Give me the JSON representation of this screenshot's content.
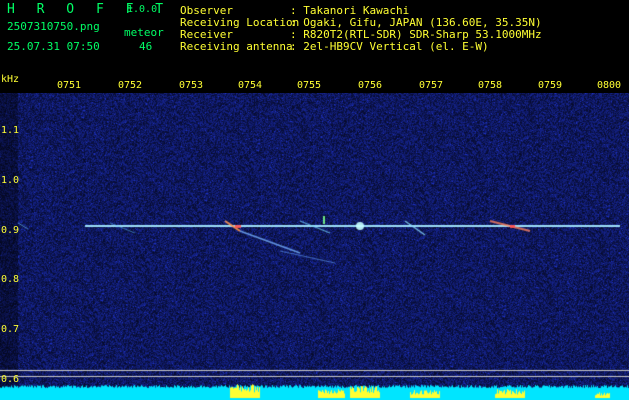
{
  "app": {
    "name": "H R O F F T",
    "version": "1.0.0"
  },
  "file": {
    "name": "2507310750.png",
    "timestamp": "25.07.31 07:50"
  },
  "meteor": {
    "label": "meteor",
    "count": "46"
  },
  "info": {
    "observer": {
      "label": "Observer",
      "value": ": Takanori Kawachi"
    },
    "location": {
      "label": "Receiving Location",
      "value": ": Ogaki, Gifu, JAPAN (136.60E, 35.35N)"
    },
    "receiver": {
      "label": "Receiver",
      "value": ": R820T2(RTL-SDR) SDR-Sharp 53.1000MHz"
    },
    "antenna": {
      "label": "Receiving antenna",
      "value": ": 2el-HB9CV Vertical (el. E-W)"
    }
  },
  "axis": {
    "unit": "kHz",
    "freq_ticks": [
      "1.1",
      "1.0",
      "0.9",
      "0.8",
      "0.7",
      "0.6"
    ],
    "time_ticks": [
      "0751",
      "0752",
      "0753",
      "0754",
      "0755",
      "0756",
      "0757",
      "0758",
      "0759",
      "0800"
    ]
  },
  "colors": {
    "background": "#000000",
    "noise": "#1a237a",
    "signal": "#7fd8ff",
    "text_yellow": "#ffff33",
    "text_green": "#00ff66",
    "floor": "#00e5ff"
  }
}
